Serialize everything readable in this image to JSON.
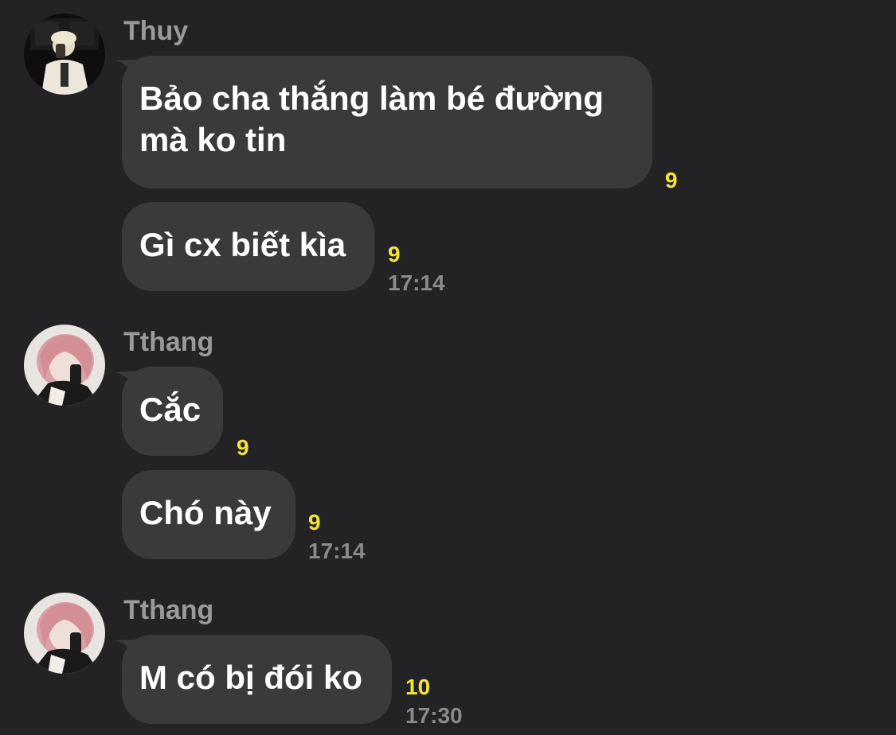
{
  "groups": [
    {
      "sender": "Thuy",
      "avatar_icon": "avatar-thuy-icon",
      "messages": [
        {
          "text": "Bảo cha thắng làm bé đường mà ko tin",
          "badge": "9",
          "time": ""
        },
        {
          "text": "Gì cx biết kìa",
          "badge": "9",
          "time": "17:14"
        }
      ]
    },
    {
      "sender": "Tthang",
      "avatar_icon": "avatar-tthang-icon",
      "messages": [
        {
          "text": "Cắc",
          "badge": "9",
          "time": ""
        },
        {
          "text": "Chó này",
          "badge": "9",
          "time": "17:14"
        }
      ]
    },
    {
      "sender": "Tthang",
      "avatar_icon": "avatar-tthang-icon",
      "messages": [
        {
          "text": "M có bị đói ko",
          "badge": "10",
          "time": "17:30"
        }
      ]
    }
  ],
  "colors": {
    "background": "#232325",
    "bubble": "#3a3a3c",
    "sender": "#9a9a9c",
    "badge": "#f5e33a",
    "time": "#8a8a8c"
  }
}
